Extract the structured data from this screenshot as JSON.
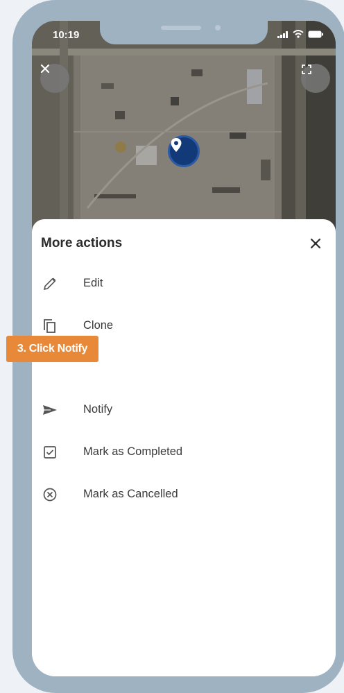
{
  "status_bar": {
    "time": "10:19"
  },
  "map": {
    "close_icon": "close-icon",
    "expand_icon": "expand-icon",
    "pin_icon": "location-pin-icon"
  },
  "sheet": {
    "title": "More actions",
    "actions": [
      {
        "label": "Edit",
        "icon": "pencil-icon"
      },
      {
        "label": "Clone",
        "icon": "copy-icon"
      },
      {
        "label": "Notify",
        "icon": "send-icon"
      },
      {
        "label": "Mark as Completed",
        "icon": "checkbox-icon"
      },
      {
        "label": "Mark as Cancelled",
        "icon": "cancel-circle-icon"
      }
    ]
  },
  "tutorial": {
    "callout_text": "3. Click Notify"
  },
  "colors": {
    "frame": "#9fb2c2",
    "callout": "#e8893a",
    "pin": "#123a78"
  }
}
